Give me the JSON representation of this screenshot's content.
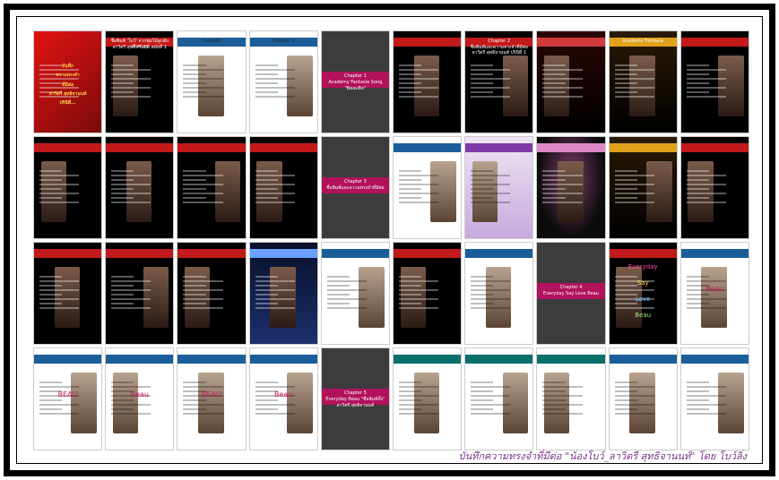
{
  "caption": "บันทึกความทรงจำที่มีต่อ \"น้องโบว์_ลาวิตรี สุทธิจานนท์\" โดย โบว์ลิ่ง",
  "thumbnails": [
    {
      "theme": "t-red",
      "texts": [
        "บันทึก",
        "ความทรงจำ",
        "ที่มีต่อ",
        "ลาวิตรี สุทธิจานนท์",
        "ปรินีที่..."
      ]
    },
    {
      "theme": "t-black",
      "texts": [
        "ชื่อพิมพ์ 'โบว์' จากพุ่มไม้ลูกลับเจ้าต่างๆ",
        "ลาวิตรี สุทธิจานนท์ สมัยที่ 1"
      ]
    },
    {
      "theme": "t-white",
      "texts": [
        "Content"
      ]
    },
    {
      "theme": "t-white",
      "texts": [
        "Chapter 1"
      ]
    },
    {
      "theme": "t-grey",
      "texts": [
        "Chapter 1",
        "Academy Fantasia Song",
        "\"BeauBo\""
      ]
    },
    {
      "theme": "t-black",
      "texts": [
        ""
      ]
    },
    {
      "theme": "t-black",
      "texts": [
        "Chapter 2",
        "ชื่อพิมพ์และความทรงจำที่มีต่อ",
        "ลาวิตรี สุทธิจานนท์ ปรินีที่ 1"
      ]
    },
    {
      "theme": "t-darkred",
      "texts": [
        ""
      ]
    },
    {
      "theme": "t-gold",
      "texts": [
        "Academy Fantasia"
      ]
    },
    {
      "theme": "t-black",
      "texts": [
        ""
      ]
    },
    {
      "theme": "t-black",
      "texts": [
        ""
      ]
    },
    {
      "theme": "t-black",
      "texts": [
        ""
      ]
    },
    {
      "theme": "t-black",
      "texts": [
        ""
      ]
    },
    {
      "theme": "t-black",
      "texts": [
        ""
      ]
    },
    {
      "theme": "t-grey",
      "texts": [
        "Chapter 3",
        "ชื่อพิมพ์และความทรงจำที่มีต่อ"
      ]
    },
    {
      "theme": "t-white",
      "texts": [
        ""
      ]
    },
    {
      "theme": "t-purple",
      "texts": [
        ""
      ]
    },
    {
      "theme": "t-stage",
      "texts": [
        ""
      ]
    },
    {
      "theme": "t-gold",
      "texts": [
        ""
      ]
    },
    {
      "theme": "t-black",
      "texts": [
        ""
      ]
    },
    {
      "theme": "t-black",
      "texts": [
        ""
      ]
    },
    {
      "theme": "t-black",
      "texts": [
        ""
      ]
    },
    {
      "theme": "t-black",
      "texts": [
        ""
      ]
    },
    {
      "theme": "t-night",
      "texts": [
        ""
      ]
    },
    {
      "theme": "t-white",
      "texts": [
        ""
      ]
    },
    {
      "theme": "t-black",
      "texts": [
        ""
      ]
    },
    {
      "theme": "t-white",
      "texts": [
        ""
      ]
    },
    {
      "theme": "t-grey",
      "texts": [
        "Chapter 4",
        "Everyday Say Love Beau"
      ]
    },
    {
      "theme": "t-black",
      "texts": [
        "Everyday",
        "Say",
        "Love",
        "Beau"
      ]
    },
    {
      "theme": "t-white",
      "texts": [
        "Beau"
      ]
    },
    {
      "theme": "t-white",
      "texts": [
        "BEAU"
      ]
    },
    {
      "theme": "t-white",
      "texts": [
        "Beau"
      ]
    },
    {
      "theme": "t-white",
      "texts": [
        "BEAU"
      ]
    },
    {
      "theme": "t-white",
      "texts": [
        "Beau"
      ]
    },
    {
      "theme": "t-grey",
      "texts": [
        "Chapter 5",
        "Everyday Beau \"ชื่อพิมพ์ทั้ง\"",
        "ลาวิตรี สุทธิจานนท์"
      ]
    },
    {
      "theme": "t-teal",
      "texts": [
        ""
      ]
    },
    {
      "theme": "t-teal",
      "texts": [
        ""
      ]
    },
    {
      "theme": "t-teal",
      "texts": [
        ""
      ]
    },
    {
      "theme": "t-white",
      "texts": [
        ""
      ]
    },
    {
      "theme": "t-white",
      "texts": [
        ""
      ]
    }
  ]
}
